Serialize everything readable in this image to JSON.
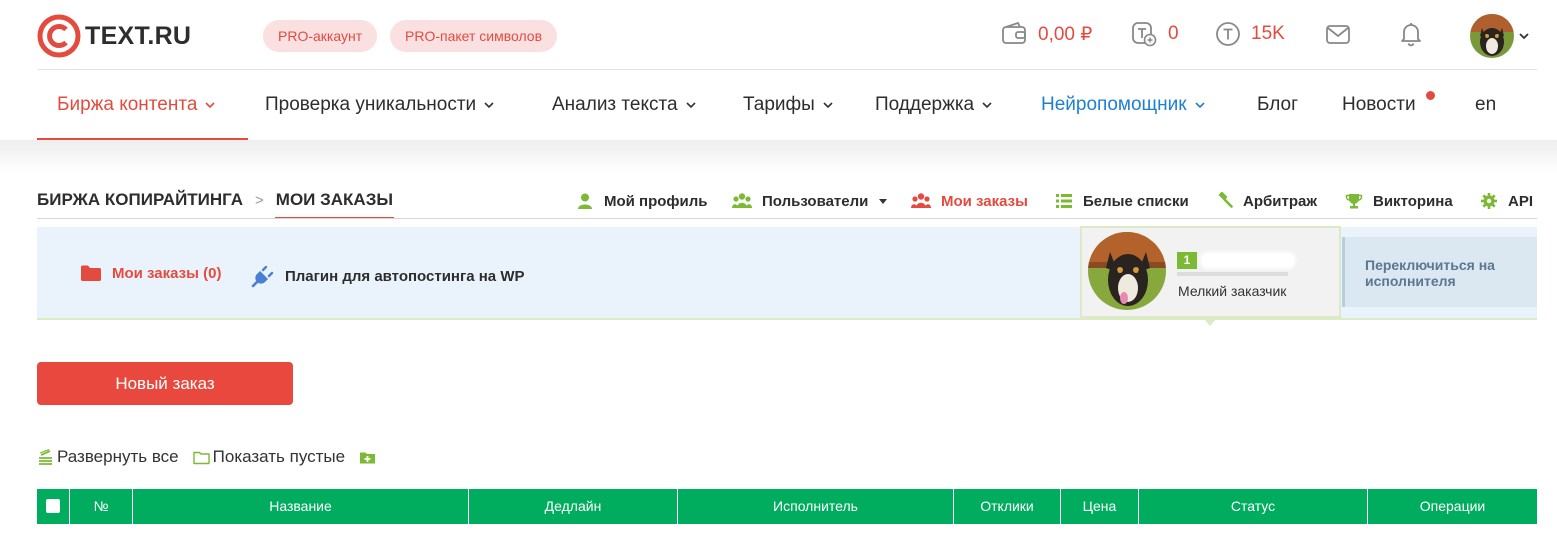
{
  "header": {
    "logo_text": "TEXT.RU",
    "pro_account": "PRO-аккаунт",
    "pro_pack": "PRO-пакет символов",
    "balance": "0,00 ₽",
    "tplus_count": "0",
    "t_count": "15K"
  },
  "nav": {
    "items": [
      {
        "label": "Биржа контента"
      },
      {
        "label": "Проверка уникальности"
      },
      {
        "label": "Анализ текста"
      },
      {
        "label": "Тарифы"
      },
      {
        "label": "Поддержка"
      },
      {
        "label": "Нейропомощник"
      },
      {
        "label": "Блог"
      },
      {
        "label": "Новости"
      },
      {
        "label": "en"
      }
    ]
  },
  "breadcrumb": {
    "root": "БИРЖА КОПИРАЙТИНГА",
    "current": "МОИ ЗАКАЗЫ"
  },
  "subnav": {
    "profile": "Мой профиль",
    "users": "Пользователи",
    "orders": "Мои заказы",
    "whitelists": "Белые списки",
    "arbitration": "Арбитраж",
    "quiz": "Викторина",
    "api": "API"
  },
  "panel": {
    "orders_link": "Мои заказы (0)",
    "plugin_link": "Плагин для автопостинга на WP",
    "level": "1",
    "role": "Мелкий заказчик",
    "switch": "Переключиться на исполнителя"
  },
  "actions": {
    "new_order": "Новый заказ",
    "expand_all": "Развернуть все",
    "show_empty": "Показать пустые"
  },
  "table": {
    "columns": [
      "№",
      "Название",
      "Дедлайн",
      "Исполнитель",
      "Отклики",
      "Цена",
      "Статус",
      "Операции"
    ]
  },
  "colors": {
    "accent": "#e44b3f",
    "nav_blue": "#1e7fd3",
    "table_header": "#00ad5f",
    "panel_bg": "#eaf3fb"
  }
}
